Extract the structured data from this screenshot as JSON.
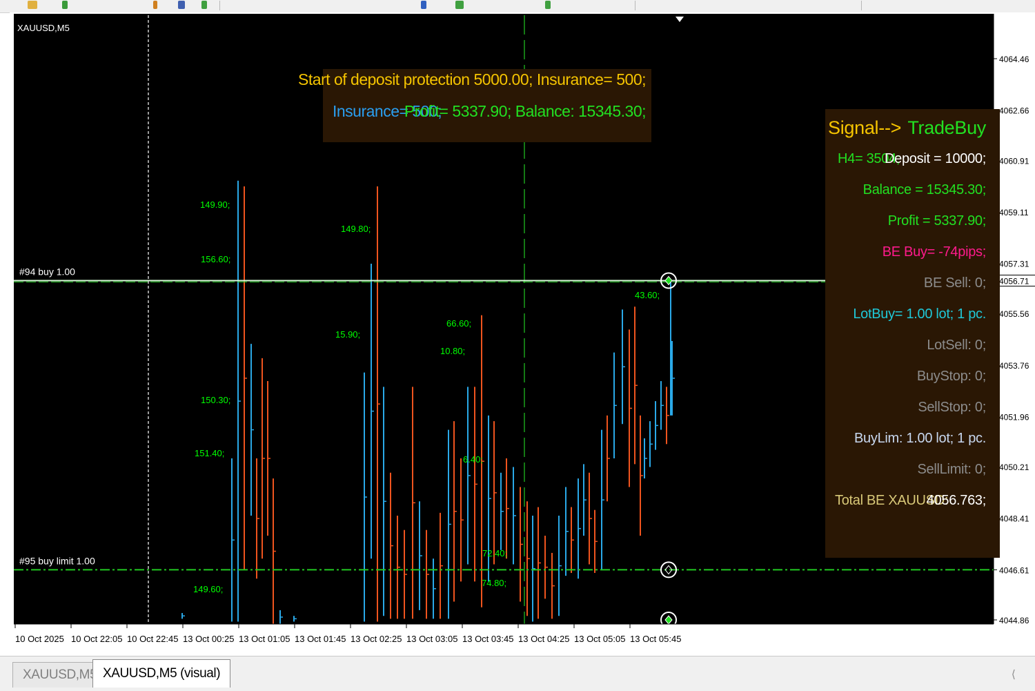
{
  "toolbar": {
    "icons": [
      "open-icon",
      "save-icon",
      "chart-icon",
      "indicator-icon",
      "zoom-in-icon",
      "zoom-out-icon",
      "grid-icon",
      "period-icon"
    ]
  },
  "chart": {
    "symbol_label": "XAUUSD,M5",
    "price_axis": [
      "4064.46",
      "4062.66",
      "4060.91",
      "4059.11",
      "4057.31",
      "4056.71",
      "4055.56",
      "4053.76",
      "4051.96",
      "4050.21",
      "4048.41",
      "4046.61",
      "4044.86"
    ],
    "time_axis": [
      "10 Oct 2025",
      "10 Oct 22:05",
      "10 Oct 22:45",
      "13 Oct 00:25",
      "13 Oct 01:05",
      "13 Oct 01:45",
      "13 Oct 02:25",
      "13 Oct 03:05",
      "13 Oct 03:45",
      "13 Oct 04:25",
      "13 Oct 05:05",
      "13 Oct 05:45"
    ],
    "orders": [
      {
        "label": "#94 buy 1.00",
        "price": 4056.71
      },
      {
        "label": "#95 buy limit 1.00",
        "price": 4046.61
      }
    ],
    "current_price": "4056.71",
    "value_labels": [
      "149.90;",
      "156.60;",
      "150.30;",
      "151.40;",
      "149.60;",
      "149.80;",
      "15.90;",
      "66.60;",
      "10.80;",
      "6.40;",
      "72.40;",
      "74.80;",
      "43.60;"
    ],
    "colors": {
      "background": "#000000",
      "bull": "#2aa9e8",
      "bear": "#f0541e",
      "order_line": "#22c922",
      "labels": "#00ff00"
    }
  },
  "top_panel": {
    "line1": "Start of deposit protection 5000.00; Insurance= 500;",
    "line2_a": "Insurance= 500;",
    "line2_b": "Profit= 5337.90; Balance: 15345.30;"
  },
  "right_panel": {
    "signal_label": "Signal-->",
    "signal_value": "TradeBuy",
    "h4": "H4= 3504;",
    "deposit": "Deposit = 10000;",
    "balance": "Balance = 15345.30;",
    "profit": "Profit = 5337.90;",
    "be_buy": "BE Buy= -74pips;",
    "be_sell": "BE Sell: 0;",
    "lot_buy": "LotBuy= 1.00 lot; 1 pc.",
    "lot_sell": "LotSell: 0;",
    "buy_stop": "BuyStop: 0;",
    "sell_stop": "SellStop: 0;",
    "buy_lim": "BuyLim: 1.00 lot; 1 pc.",
    "sell_limit": "SellLimit: 0;",
    "total_be_label": "Total BE XAUUSD:",
    "total_be_value": "4056.763;"
  },
  "tabs": [
    {
      "label": "XAUUSD,M5",
      "active": false
    },
    {
      "label": "XAUUSD,M5 (visual)",
      "active": true
    }
  ]
}
